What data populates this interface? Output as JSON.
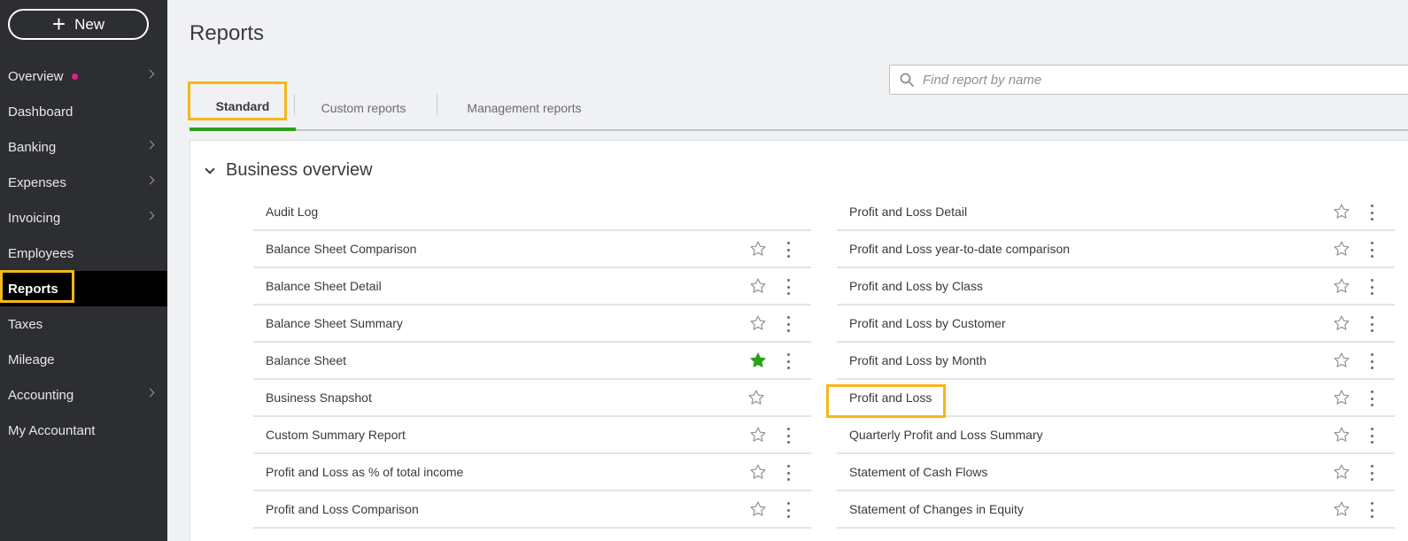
{
  "sidebar": {
    "new_label": "New",
    "items": [
      {
        "label": "Overview",
        "chevron": true,
        "dot": true
      },
      {
        "label": "Dashboard",
        "chevron": false
      },
      {
        "label": "Banking",
        "chevron": true
      },
      {
        "label": "Expenses",
        "chevron": true
      },
      {
        "label": "Invoicing",
        "chevron": true
      },
      {
        "label": "Employees",
        "chevron": false
      },
      {
        "label": "Reports",
        "chevron": false,
        "active": true
      },
      {
        "label": "Taxes",
        "chevron": false
      },
      {
        "label": "Mileage",
        "chevron": false
      },
      {
        "label": "Accounting",
        "chevron": true
      },
      {
        "label": "My Accountant",
        "chevron": false
      }
    ]
  },
  "page": {
    "title": "Reports"
  },
  "tabs": [
    {
      "label": "Standard",
      "active": true
    },
    {
      "label": "Custom reports"
    },
    {
      "label": "Management reports"
    }
  ],
  "search": {
    "placeholder": "Find report by name"
  },
  "section": {
    "title": "Business overview",
    "left": [
      {
        "name": "Audit Log",
        "star": "none",
        "menu": false
      },
      {
        "name": "Balance Sheet Comparison",
        "star": "outline",
        "menu": true
      },
      {
        "name": "Balance Sheet Detail",
        "star": "outline",
        "menu": true
      },
      {
        "name": "Balance Sheet Summary",
        "star": "outline",
        "menu": true
      },
      {
        "name": "Balance Sheet",
        "star": "filled",
        "menu": true
      },
      {
        "name": "Business Snapshot",
        "star": "outline",
        "menu": false
      },
      {
        "name": "Custom Summary Report",
        "star": "outline",
        "menu": true
      },
      {
        "name": "Profit and Loss as % of total income",
        "star": "outline",
        "menu": true
      },
      {
        "name": "Profit and Loss Comparison",
        "star": "outline",
        "menu": true
      }
    ],
    "right": [
      {
        "name": "Profit and Loss Detail",
        "star": "outline",
        "menu": true
      },
      {
        "name": "Profit and Loss year-to-date comparison",
        "star": "outline",
        "menu": true
      },
      {
        "name": "Profit and Loss by Class",
        "star": "outline",
        "menu": true
      },
      {
        "name": "Profit and Loss by Customer",
        "star": "outline",
        "menu": true
      },
      {
        "name": "Profit and Loss by Month",
        "star": "outline",
        "menu": true
      },
      {
        "name": "Profit and Loss",
        "star": "outline",
        "menu": true
      },
      {
        "name": "Quarterly Profit and Loss Summary",
        "star": "outline",
        "menu": true
      },
      {
        "name": "Statement of Cash Flows",
        "star": "outline",
        "menu": true
      },
      {
        "name": "Statement of Changes in Equity",
        "star": "outline",
        "menu": true
      }
    ]
  },
  "colors": {
    "accent_green": "#2ca01c",
    "highlight": "#f5b71a",
    "sidebar_bg": "#2d2e31",
    "notify_dot": "#e0218a"
  }
}
